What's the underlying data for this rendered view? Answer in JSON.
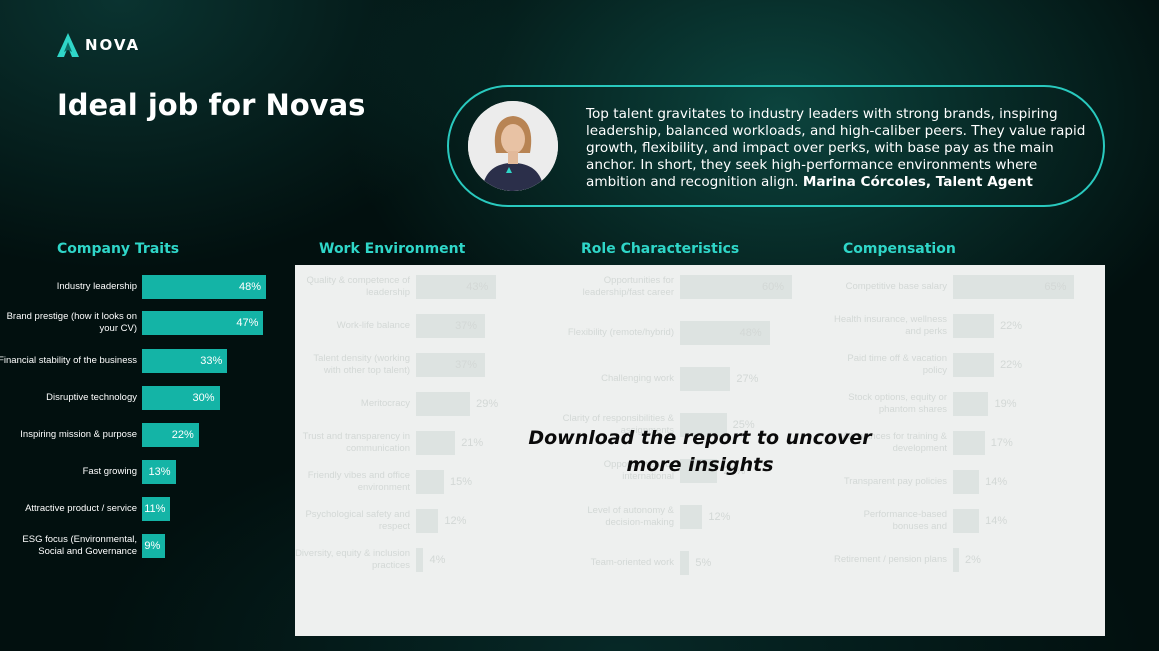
{
  "brand": {
    "name": "NOVA",
    "accent": "#2fd6c8",
    "bar_color": "#14b4a6"
  },
  "title": {
    "bold": "Ideal job",
    "rest": " for Novas"
  },
  "quote": {
    "text": "Top talent gravitates to industry leaders with strong brands, inspiring leadership, balanced workloads, and high-caliber peers. They value rapid growth, flexibility, and impact over perks, with base pay as the main anchor. In short, they seek high-performance environments where ambition and recognition align. ",
    "author": "Marina Córcoles, Talent Agent"
  },
  "sections": {
    "company_traits": "Company Traits",
    "work_environment": "Work Environment",
    "role_characteristics": "Role Characteristics",
    "compensation": "Compensation"
  },
  "chart_data": [
    {
      "type": "bar",
      "title": "Company Traits",
      "categories": [
        "Industry leadership",
        "Brand prestige (how it looks on your CV)",
        "Financial stability of the business",
        "Disruptive technology",
        "Inspiring mission & purpose",
        "Fast growing",
        "Attractive product / service",
        "ESG focus (Environmental, Social and Governance"
      ],
      "values": [
        48,
        47,
        33,
        30,
        22,
        13,
        11,
        9
      ],
      "value_labels": [
        "48%",
        "47%",
        "33%",
        "30%",
        "22%",
        "13%",
        "11%",
        "9%"
      ]
    },
    {
      "type": "bar",
      "title": "Work Environment",
      "categories": [
        "Quality & competence of leadership",
        "Work-life balance",
        "Talent density (working with other top talent)",
        "Meritocracy",
        "Trust and transparency in communication",
        "Friendly vibes and office environment",
        "Psychological safety and respect",
        "Diversity, equity & inclusion practices"
      ],
      "values": [
        43,
        37,
        37,
        29,
        21,
        15,
        12,
        4
      ],
      "value_labels": [
        "43%",
        "37%",
        "37%",
        "29%",
        "21%",
        "15%",
        "12%",
        "4%"
      ]
    },
    {
      "type": "bar",
      "title": "Role Characteristics",
      "categories": [
        "Opportunities for leadership/fast career",
        "Flexibility (remote/hybrid)",
        "Challenging work",
        "Clarity of responsibilities & assignments",
        "Opportunities for international",
        "Level of autonomy & decision-making",
        "Team-oriented work"
      ],
      "values": [
        60,
        48,
        27,
        25,
        20,
        12,
        5
      ],
      "value_labels": [
        "60%",
        "48%",
        "27%",
        "25%",
        "20%",
        "12%",
        "5%"
      ]
    },
    {
      "type": "bar",
      "title": "Compensation",
      "categories": [
        "Competitive base salary",
        "Health insurance, wellness and perks",
        "Paid time off & vacation policy",
        "Stock options, equity or phantom shares",
        "Allowances for training & development",
        "Transparent pay policies",
        "Performance-based bonuses and",
        "Retirement / pension plans"
      ],
      "values": [
        65,
        22,
        22,
        19,
        17,
        14,
        14,
        2
      ],
      "value_labels": [
        "65%",
        "22%",
        "22%",
        "19%",
        "17%",
        "14%",
        "14%",
        "2%"
      ]
    }
  ],
  "cta": {
    "line1": "Download the report to uncover",
    "line2": "more insights"
  }
}
